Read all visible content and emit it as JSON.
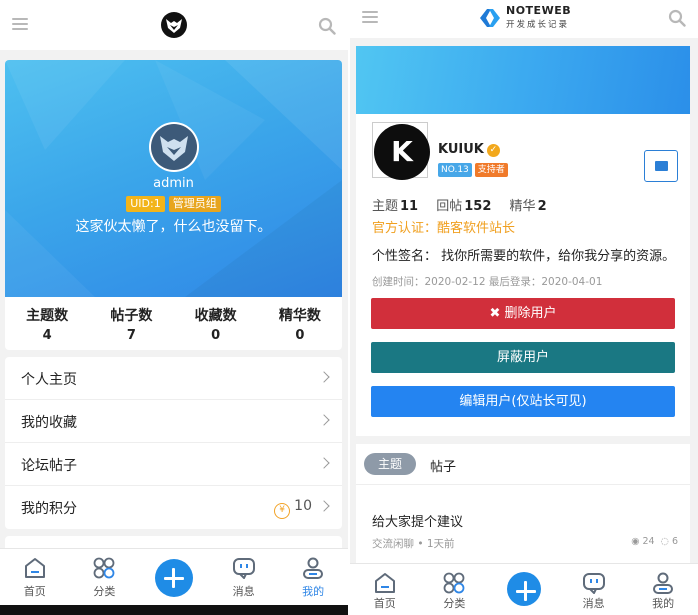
{
  "left": {
    "profile": {
      "name": "admin",
      "uid_badge": "UID:1",
      "role_badge": "管理员组",
      "bio": "这家伙太懒了，什么也没留下。"
    },
    "stats": [
      {
        "label": "主题数",
        "value": "4"
      },
      {
        "label": "帖子数",
        "value": "7"
      },
      {
        "label": "收藏数",
        "value": "0"
      },
      {
        "label": "精华数",
        "value": "0"
      }
    ],
    "menu": [
      {
        "label": "个人主页"
      },
      {
        "label": "我的收藏"
      },
      {
        "label": "论坛帖子"
      },
      {
        "label": "我的积分",
        "value": "10",
        "coin": "¥"
      }
    ]
  },
  "tabs": [
    {
      "label": "首页",
      "icon": "home-icon"
    },
    {
      "label": "分类",
      "icon": "category-icon"
    },
    {
      "label": "",
      "icon": "plus-icon"
    },
    {
      "label": "消息",
      "icon": "message-icon"
    },
    {
      "label": "我的",
      "icon": "user-icon"
    }
  ],
  "right": {
    "brand": {
      "name": "NOTEWEB",
      "subtitle": "开发成长记录"
    },
    "user": {
      "avatar_letter": "K",
      "name": "KUIUK",
      "rank_tag": "NO.13",
      "supporter_tag": "支持者",
      "counts": [
        {
          "label": "主题",
          "value": "11"
        },
        {
          "label": "回帖",
          "value": "152"
        },
        {
          "label": "精华",
          "value": "2"
        }
      ],
      "official": "官方认证：酷客软件站长",
      "signature": "个性签名：  找你所需要的软件，给你我分享的资源。",
      "meta": "创建时间：2020-02-12 最后登录：2020-04-01"
    },
    "buttons": {
      "delete": "删除用户",
      "block": "屏蔽用户",
      "edit": "编辑用户(仅站长可见)"
    },
    "segments": {
      "active": "主题",
      "other": "帖子"
    },
    "post": {
      "title": "给大家提个建议",
      "meta": "交流闲聊 • 1天前",
      "views": "24",
      "comments": "6"
    }
  },
  "colors": {
    "accent": "#2f86e6",
    "danger": "#d12f3b",
    "teal": "#1a7883",
    "primary": "#2484f1",
    "gold": "#f0a020"
  }
}
